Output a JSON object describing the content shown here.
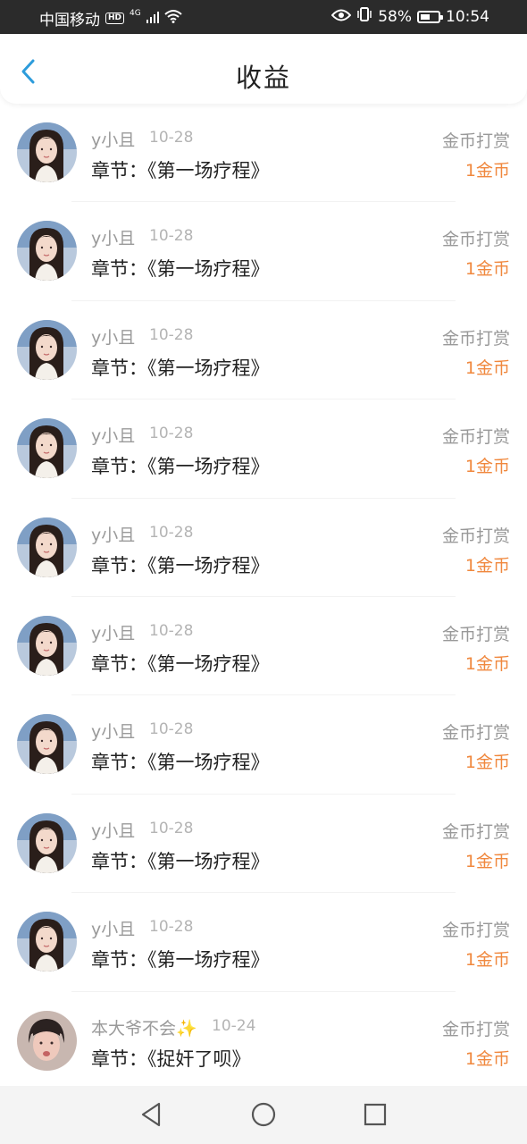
{
  "status_bar": {
    "carrier": "中国移动",
    "hd": "HD",
    "network": "4G",
    "battery": "58%",
    "time": "10:54",
    "battery_level": 0.58
  },
  "header": {
    "title": "收益",
    "back_icon": "chevron-left-icon",
    "accent": "#2d9cdb"
  },
  "colors": {
    "amount": "#f0883e",
    "name": "#9a9a9a",
    "title": "#222222"
  },
  "records": [
    {
      "name": "y小且",
      "date": "10-28",
      "chapter_label": "章节：",
      "chapter": "《第一场疗程》",
      "type": "金币打赏",
      "amount": "1金币",
      "avatar": "girl"
    },
    {
      "name": "y小且",
      "date": "10-28",
      "chapter_label": "章节：",
      "chapter": "《第一场疗程》",
      "type": "金币打赏",
      "amount": "1金币",
      "avatar": "girl"
    },
    {
      "name": "y小且",
      "date": "10-28",
      "chapter_label": "章节：",
      "chapter": "《第一场疗程》",
      "type": "金币打赏",
      "amount": "1金币",
      "avatar": "girl"
    },
    {
      "name": "y小且",
      "date": "10-28",
      "chapter_label": "章节：",
      "chapter": "《第一场疗程》",
      "type": "金币打赏",
      "amount": "1金币",
      "avatar": "girl"
    },
    {
      "name": "y小且",
      "date": "10-28",
      "chapter_label": "章节：",
      "chapter": "《第一场疗程》",
      "type": "金币打赏",
      "amount": "1金币",
      "avatar": "girl"
    },
    {
      "name": "y小且",
      "date": "10-28",
      "chapter_label": "章节：",
      "chapter": "《第一场疗程》",
      "type": "金币打赏",
      "amount": "1金币",
      "avatar": "girl"
    },
    {
      "name": "y小且",
      "date": "10-28",
      "chapter_label": "章节：",
      "chapter": "《第一场疗程》",
      "type": "金币打赏",
      "amount": "1金币",
      "avatar": "girl"
    },
    {
      "name": "y小且",
      "date": "10-28",
      "chapter_label": "章节：",
      "chapter": "《第一场疗程》",
      "type": "金币打赏",
      "amount": "1金币",
      "avatar": "girl"
    },
    {
      "name": "y小且",
      "date": "10-28",
      "chapter_label": "章节：",
      "chapter": "《第一场疗程》",
      "type": "金币打赏",
      "amount": "1金币",
      "avatar": "girl"
    },
    {
      "name": "本大爷不会✨",
      "date": "10-24",
      "chapter_label": "章节：",
      "chapter": "《捉奸了呗》",
      "type": "金币打赏",
      "amount": "1金币",
      "avatar": "boy"
    }
  ],
  "bottom_nav": {
    "back": "triangle-back-icon",
    "home": "circle-home-icon",
    "recents": "square-recents-icon"
  }
}
